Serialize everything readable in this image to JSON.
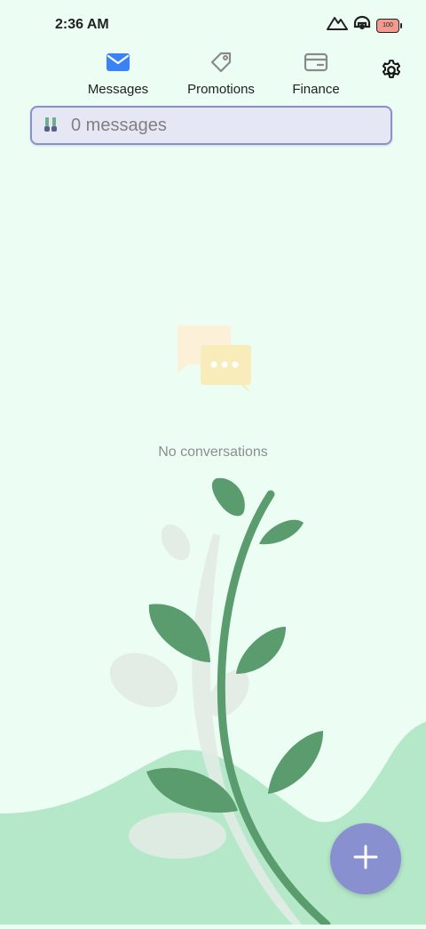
{
  "status_bar": {
    "time": "2:36 AM",
    "battery_level": "100",
    "icons": [
      "signal-icon",
      "headset-icon",
      "battery-icon"
    ]
  },
  "tabs": [
    {
      "label": "Messages",
      "icon": "envelope-icon",
      "active": true
    },
    {
      "label": "Promotions",
      "icon": "tag-icon",
      "active": false
    },
    {
      "label": "Finance",
      "icon": "card-icon",
      "active": false
    }
  ],
  "settings": {
    "icon": "gear-icon"
  },
  "search": {
    "placeholder": "0 messages",
    "value": ""
  },
  "empty_state": {
    "text": "No conversations",
    "icon": "chat-bubbles-icon"
  },
  "fab": {
    "icon": "plus-icon"
  },
  "colors": {
    "background": "#ecfdf3",
    "accent": "#3b82f6",
    "search_border": "#8a8fd0",
    "fab": "#8990cf",
    "leaf": "#5a9c6e",
    "hill": "#b5e8c9"
  }
}
